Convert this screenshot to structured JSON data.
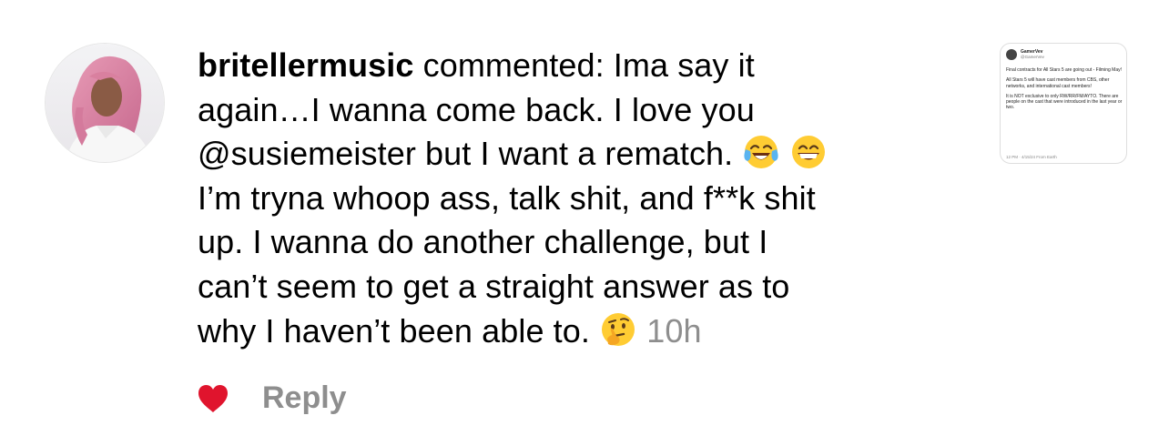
{
  "comment": {
    "username": "britellermusic",
    "line1_rest": " commented: Ima say it",
    "line2": "again…I wanna come back. I love you",
    "line3_text": "@susiemeister but I want a rematch. ",
    "line4": "I’m tryna whoop ass, talk shit, and f**k shit",
    "line5": "up. I wanna do another challenge, but I",
    "line6": "can’t seem to get a straight answer as to",
    "line7_text": "why I haven’t been able to. ",
    "timestamp": "10h",
    "emojis": [
      "tears-of-joy-emoji",
      "grinning-face-emoji",
      "thinking-face-emoji"
    ]
  },
  "thumbnail": {
    "name": "GamerVev",
    "handle": "@GamerVev",
    "p1": "Final contracts for All Stars 5 are going out - Filming May!",
    "p2": "All Stars 5 will have cast members from CBS, other networks, and international cast members!",
    "p3": "It is NOT exclusive to only RW/RR/FM/AYTO. There are people on the cast that were introduced in the last year or two.",
    "meta": "12 PM · 4/15/24 From Earth"
  },
  "actions": {
    "reply_label": "Reply",
    "like_icon": "heart-icon",
    "like_color": "#e0142d"
  },
  "colors": {
    "timestamp": "#8e8e8e",
    "reply": "#8e8e8e"
  }
}
